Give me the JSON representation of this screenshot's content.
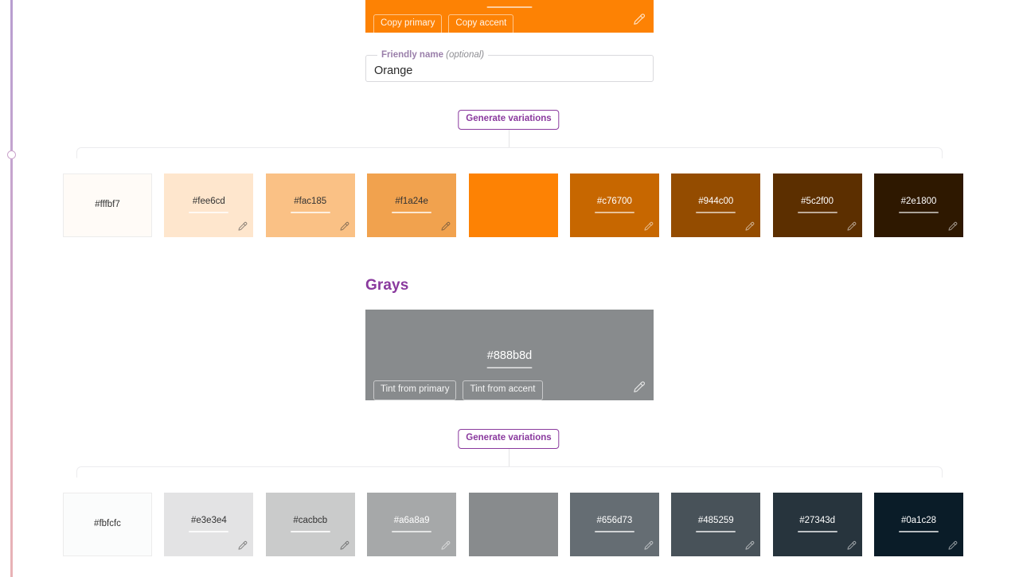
{
  "timeline": {
    "node_label": "scroll-position-marker"
  },
  "primary_card": {
    "background": "#fd8204",
    "copy_primary_label": "Copy primary",
    "copy_accent_label": "Copy accent",
    "eyedropper_icon": "eyedropper-icon"
  },
  "friendly_name": {
    "legend": "Friendly name",
    "legend_optional": "(optional)",
    "value": "Orange",
    "placeholder": ""
  },
  "primary_generate": {
    "label": "Generate variations"
  },
  "primary_swatches": [
    {
      "hex": "#fffbf7",
      "label": "#fffbf7",
      "text_color": "#333333",
      "underline": "",
      "has_dropper": false,
      "bordered": true
    },
    {
      "hex": "#fee6cd",
      "label": "#fee6cd",
      "text_color": "#333333",
      "underline": "rgba(255,255,255,0.75)",
      "has_dropper": true,
      "bordered": false
    },
    {
      "hex": "#fac185",
      "label": "#fac185",
      "text_color": "#333333",
      "underline": "rgba(255,255,255,0.75)",
      "has_dropper": true,
      "bordered": false
    },
    {
      "hex": "#f1a24e",
      "label": "#f1a24e",
      "text_color": "#333333",
      "underline": "rgba(255,255,255,0.75)",
      "has_dropper": true,
      "bordered": false
    },
    {
      "hex": "#fd8204",
      "label": "",
      "text_color": "#ffffff",
      "underline": "",
      "has_dropper": false,
      "bordered": false
    },
    {
      "hex": "#c76700",
      "label": "#c76700",
      "text_color": "#ffffff",
      "underline": "rgba(255,255,255,0.6)",
      "has_dropper": true,
      "bordered": false
    },
    {
      "hex": "#944c00",
      "label": "#944c00",
      "text_color": "#ffffff",
      "underline": "rgba(255,255,255,0.6)",
      "has_dropper": true,
      "bordered": false
    },
    {
      "hex": "#5c2f00",
      "label": "#5c2f00",
      "text_color": "#ffffff",
      "underline": "rgba(255,255,255,0.6)",
      "has_dropper": true,
      "bordered": false
    },
    {
      "hex": "#2e1800",
      "label": "#2e1800",
      "text_color": "#ffffff",
      "underline": "rgba(255,255,255,0.6)",
      "has_dropper": true,
      "bordered": false
    }
  ],
  "grays_section": {
    "heading": "Grays",
    "card": {
      "background": "#888b8d",
      "hex": "#888b8d",
      "tint_primary_label": "Tint from primary",
      "tint_accent_label": "Tint from accent",
      "eyedropper_icon": "eyedropper-icon"
    },
    "generate_label": "Generate variations"
  },
  "gray_swatches": [
    {
      "hex": "#fbfcfc",
      "label": "#fbfcfc",
      "text_color": "#333333",
      "underline": "",
      "has_dropper": false,
      "bordered": true
    },
    {
      "hex": "#e3e3e4",
      "label": "#e3e3e4",
      "text_color": "#333333",
      "underline": "rgba(255,255,255,0.85)",
      "has_dropper": true,
      "bordered": false
    },
    {
      "hex": "#cacbcb",
      "label": "#cacbcb",
      "text_color": "#333333",
      "underline": "rgba(255,255,255,0.85)",
      "has_dropper": true,
      "bordered": false
    },
    {
      "hex": "#a6a8a9",
      "label": "#a6a8a9",
      "text_color": "#ffffff",
      "underline": "rgba(255,255,255,0.7)",
      "has_dropper": true,
      "bordered": false
    },
    {
      "hex": "#888b8d",
      "label": "",
      "text_color": "#ffffff",
      "underline": "",
      "has_dropper": false,
      "bordered": false
    },
    {
      "hex": "#656d73",
      "label": "#656d73",
      "text_color": "#ffffff",
      "underline": "rgba(255,255,255,0.7)",
      "has_dropper": true,
      "bordered": false
    },
    {
      "hex": "#485259",
      "label": "#485259",
      "text_color": "#ffffff",
      "underline": "rgba(255,255,255,0.7)",
      "has_dropper": true,
      "bordered": false
    },
    {
      "hex": "#27343d",
      "label": "#27343d",
      "text_color": "#ffffff",
      "underline": "rgba(255,255,255,0.7)",
      "has_dropper": true,
      "bordered": false
    },
    {
      "hex": "#0a1c28",
      "label": "#0a1c28",
      "text_color": "#ffffff",
      "underline": "rgba(255,255,255,0.7)",
      "has_dropper": true,
      "bordered": false
    }
  ]
}
